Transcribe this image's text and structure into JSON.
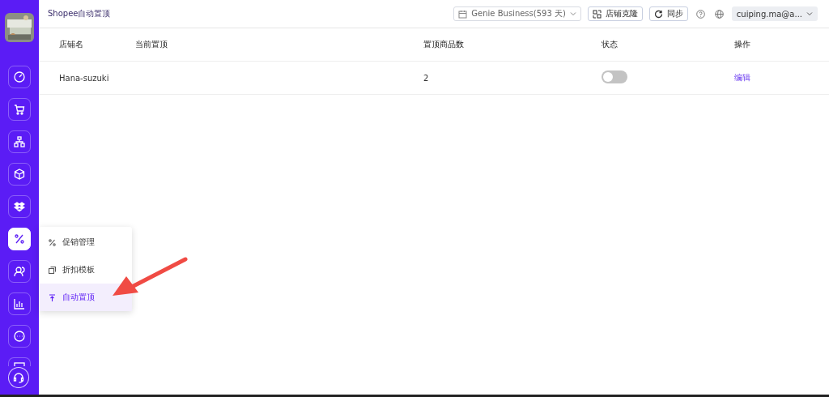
{
  "header": {
    "title": "Shopee自动置顶",
    "plan": "Genie Business(593 天)",
    "clone_button": "店铺克隆",
    "sync_button": "同步",
    "account": "cuiping.ma@a..."
  },
  "sidebar": {
    "items": [
      {
        "selected": false
      },
      {
        "selected": false
      },
      {
        "selected": false
      },
      {
        "selected": false
      },
      {
        "selected": false
      },
      {
        "selected": true
      },
      {
        "selected": false
      },
      {
        "selected": false
      },
      {
        "selected": false
      },
      {
        "selected": false
      }
    ]
  },
  "table": {
    "columns": [
      "店铺名",
      "当前置顶",
      "置顶商品数",
      "状态",
      "操作"
    ],
    "rows": [
      {
        "shop": "Hana-suzuki",
        "count": "2",
        "on": false,
        "action": "编辑"
      }
    ]
  },
  "popup_menu": {
    "items": [
      {
        "label": "促销管理",
        "selected": false
      },
      {
        "label": "折扣模板",
        "selected": false
      },
      {
        "label": "自动置顶",
        "selected": true
      }
    ]
  }
}
